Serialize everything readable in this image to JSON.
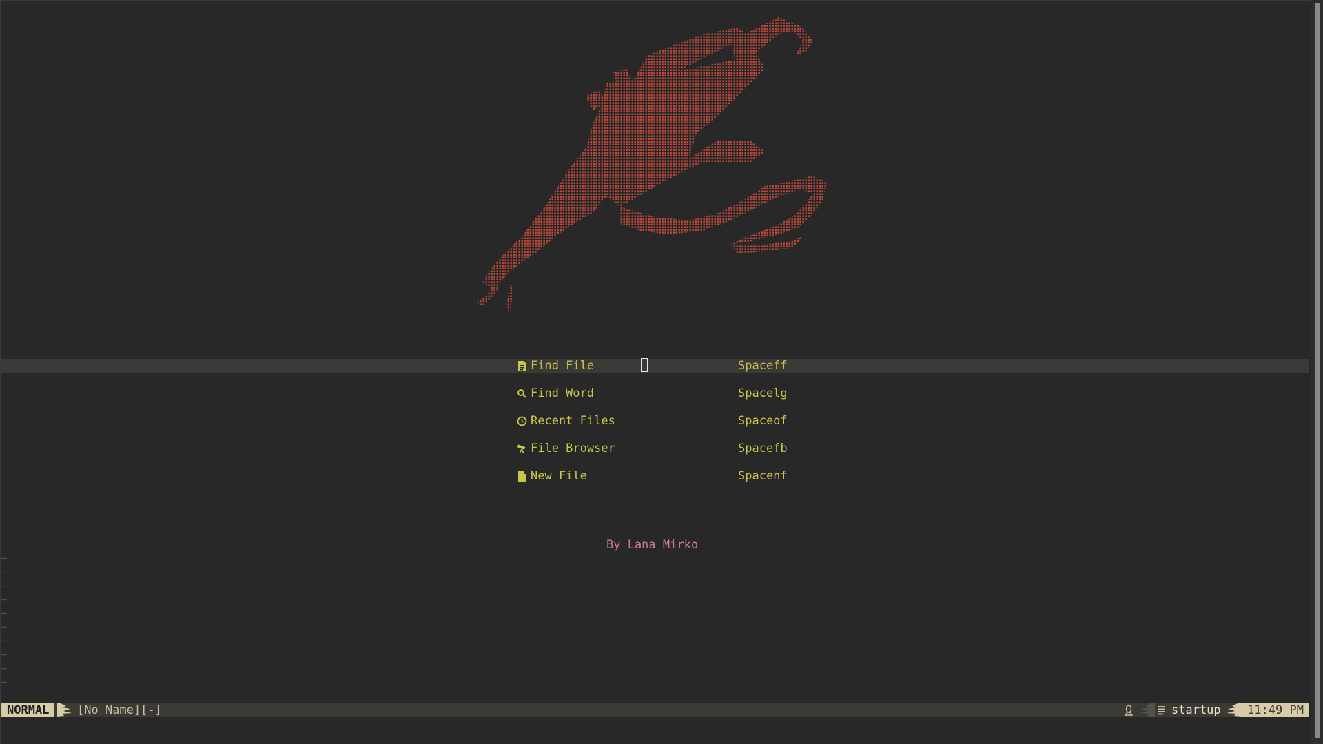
{
  "editor": {
    "app": "neovim",
    "theme_colors": {
      "background": "#282828",
      "logo": "#c94a3a",
      "menu_text": "#c9c44a",
      "footer": "#d27a8a",
      "statusline_bg": "#3c3a34",
      "mode_bg": "#d8cba8"
    }
  },
  "dashboard": {
    "logo": {
      "icon": "splatter-logo-icon"
    },
    "menu": [
      {
        "icon": "file-icon",
        "label": "Find File",
        "key": "Spaceff"
      },
      {
        "icon": "search-icon",
        "label": "Find Word",
        "key": "Spacelg"
      },
      {
        "icon": "history-icon",
        "label": "Recent Files",
        "key": "Spaceof"
      },
      {
        "icon": "telescope-icon",
        "label": "File Browser",
        "key": "Spacefb"
      },
      {
        "icon": "new-file-icon",
        "label": "New File",
        "key": "Spacenf"
      }
    ],
    "footer": "By Lana Mirko"
  },
  "statusline": {
    "mode": "NORMAL",
    "filename": "[No Name][-]",
    "os_icon": "linux-penguin-icon",
    "filetype_icon": "filetype-lines-icon",
    "filetype": "startup",
    "time": "11:49 PM"
  },
  "buffer": {
    "empty_line_marker": "~"
  }
}
